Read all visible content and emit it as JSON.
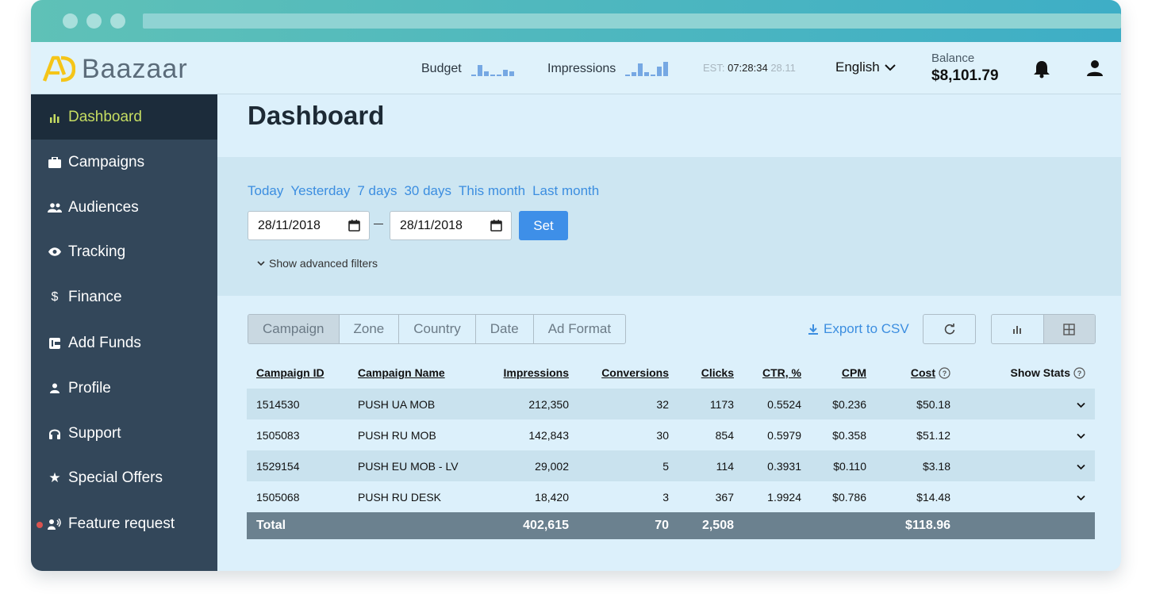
{
  "app": {
    "name": "Baazaar"
  },
  "topbar": {
    "budget_label": "Budget",
    "impressions_label": "Impressions",
    "clock_label": "EST:",
    "clock_time": "07:28:34",
    "clock_date": "28.11",
    "language": "English",
    "balance_label": "Balance",
    "balance_value": "$8,101.79"
  },
  "sidebar": {
    "items": [
      {
        "label": "Dashboard",
        "icon": "bar-chart-icon"
      },
      {
        "label": "Campaigns",
        "icon": "briefcase-icon"
      },
      {
        "label": "Audiences",
        "icon": "people-icon"
      },
      {
        "label": "Tracking",
        "icon": "eye-icon"
      },
      {
        "label": "Finance",
        "icon": "dollar-icon"
      },
      {
        "label": "Add Funds",
        "icon": "wallet-icon"
      },
      {
        "label": "Profile",
        "icon": "person-icon"
      },
      {
        "label": "Support",
        "icon": "headset-icon"
      },
      {
        "label": "Special Offers",
        "icon": "star-icon"
      },
      {
        "label": "Feature request",
        "icon": "speaker-person-icon"
      }
    ]
  },
  "main": {
    "title": "Dashboard",
    "quick_ranges": [
      "Today",
      "Yesterday",
      "7 days",
      "30 days",
      "This month",
      "Last month"
    ],
    "date_from": "28/11/2018",
    "date_to": "28/11/2018",
    "set_label": "Set",
    "advanced_filters_label": "Show advanced filters",
    "group_tabs": [
      "Campaign",
      "Zone",
      "Country",
      "Date",
      "Ad Format"
    ],
    "export_label": "Export to CSV",
    "table": {
      "headers": [
        "Campaign ID",
        "Campaign Name",
        "Impressions",
        "Conversions",
        "Clicks",
        "CTR, %",
        "CPM",
        "Cost",
        "Show Stats"
      ],
      "rows": [
        [
          "1514530",
          "PUSH UA MOB",
          "212,350",
          "32",
          "1173",
          "0.5524",
          "$0.236",
          "$50.18"
        ],
        [
          "1505083",
          "PUSH RU MOB",
          "142,843",
          "30",
          "854",
          "0.5979",
          "$0.358",
          "$51.12"
        ],
        [
          "1529154",
          "PUSH EU MOB - LV",
          "29,002",
          "5",
          "114",
          "0.3931",
          "$0.110",
          "$3.18"
        ],
        [
          "1505068",
          "PUSH RU DESK",
          "18,420",
          "3",
          "367",
          "1.9924",
          "$0.786",
          "$14.48"
        ]
      ],
      "total": {
        "label": "Total",
        "impressions": "402,615",
        "conversions": "70",
        "clicks": "2,508",
        "cost": "$118.96"
      }
    }
  },
  "colors": {
    "accent": "#3e8fe8",
    "sidebar": "#33475a",
    "sidebar_active_text": "#c6dd62",
    "logo_yellow": "#f5c518"
  }
}
